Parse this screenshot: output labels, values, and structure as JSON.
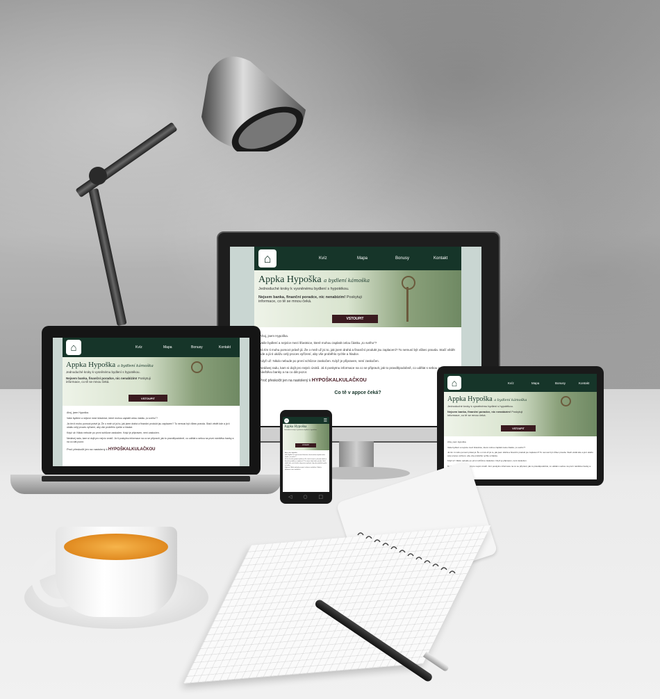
{
  "site": {
    "nav": [
      "Kvíz",
      "Mapa",
      "Bonusy",
      "Kontakt"
    ],
    "logo": "⌂",
    "title": "Appka Hypoška",
    "tagline": "a bydlení kámoška",
    "intro": "Jednoduché kroky k vysněnému bydlení s hypotékou.",
    "hero_bold": "Nejsem banka, finanční poradce, nic nenabízím!",
    "hero_rest": "Poskytuji informace, co tě se mnou čeká.",
    "cta": "VSTOUPIT",
    "greeting": "Ahoj, jsem Hypoška.",
    "p1": "Vaše bydlení a nejvíce mezi šťastnice, které mohou zaplatit celou částku „to svého\"?",
    "p2": "Já tím ti mohu pomoct právě já. Že o mně už jsi to, jak jsem drahá a finanční produkt jsu zaplacení? To nemusí být vůbec pravda. Stačí vědět kde a já ti ukážu celý proces vyřízení, aby vše proběhlo rychle a hladce.",
    "p3": "Když už: Nikdo nebude po první schůzce zaskočen. Když je připraven, není zaskočen.",
    "p4": "Nedávej radu, kam si dojít pro nejvíc úroků. Já ti poskytnu informace na co se připravit, jak to pravděpodobně, co udělat s sebou na první návštěvu banky a na co dát pozor.",
    "link_prefix": "Proč přeskočit jen na nastolený k",
    "link": "HYPOŠKALKULAČKOU",
    "sub": "Co tě v appce čeká?"
  },
  "colors": {
    "nav": "#163529",
    "cta": "#3a1a1f",
    "accent": "#4a1f28"
  }
}
